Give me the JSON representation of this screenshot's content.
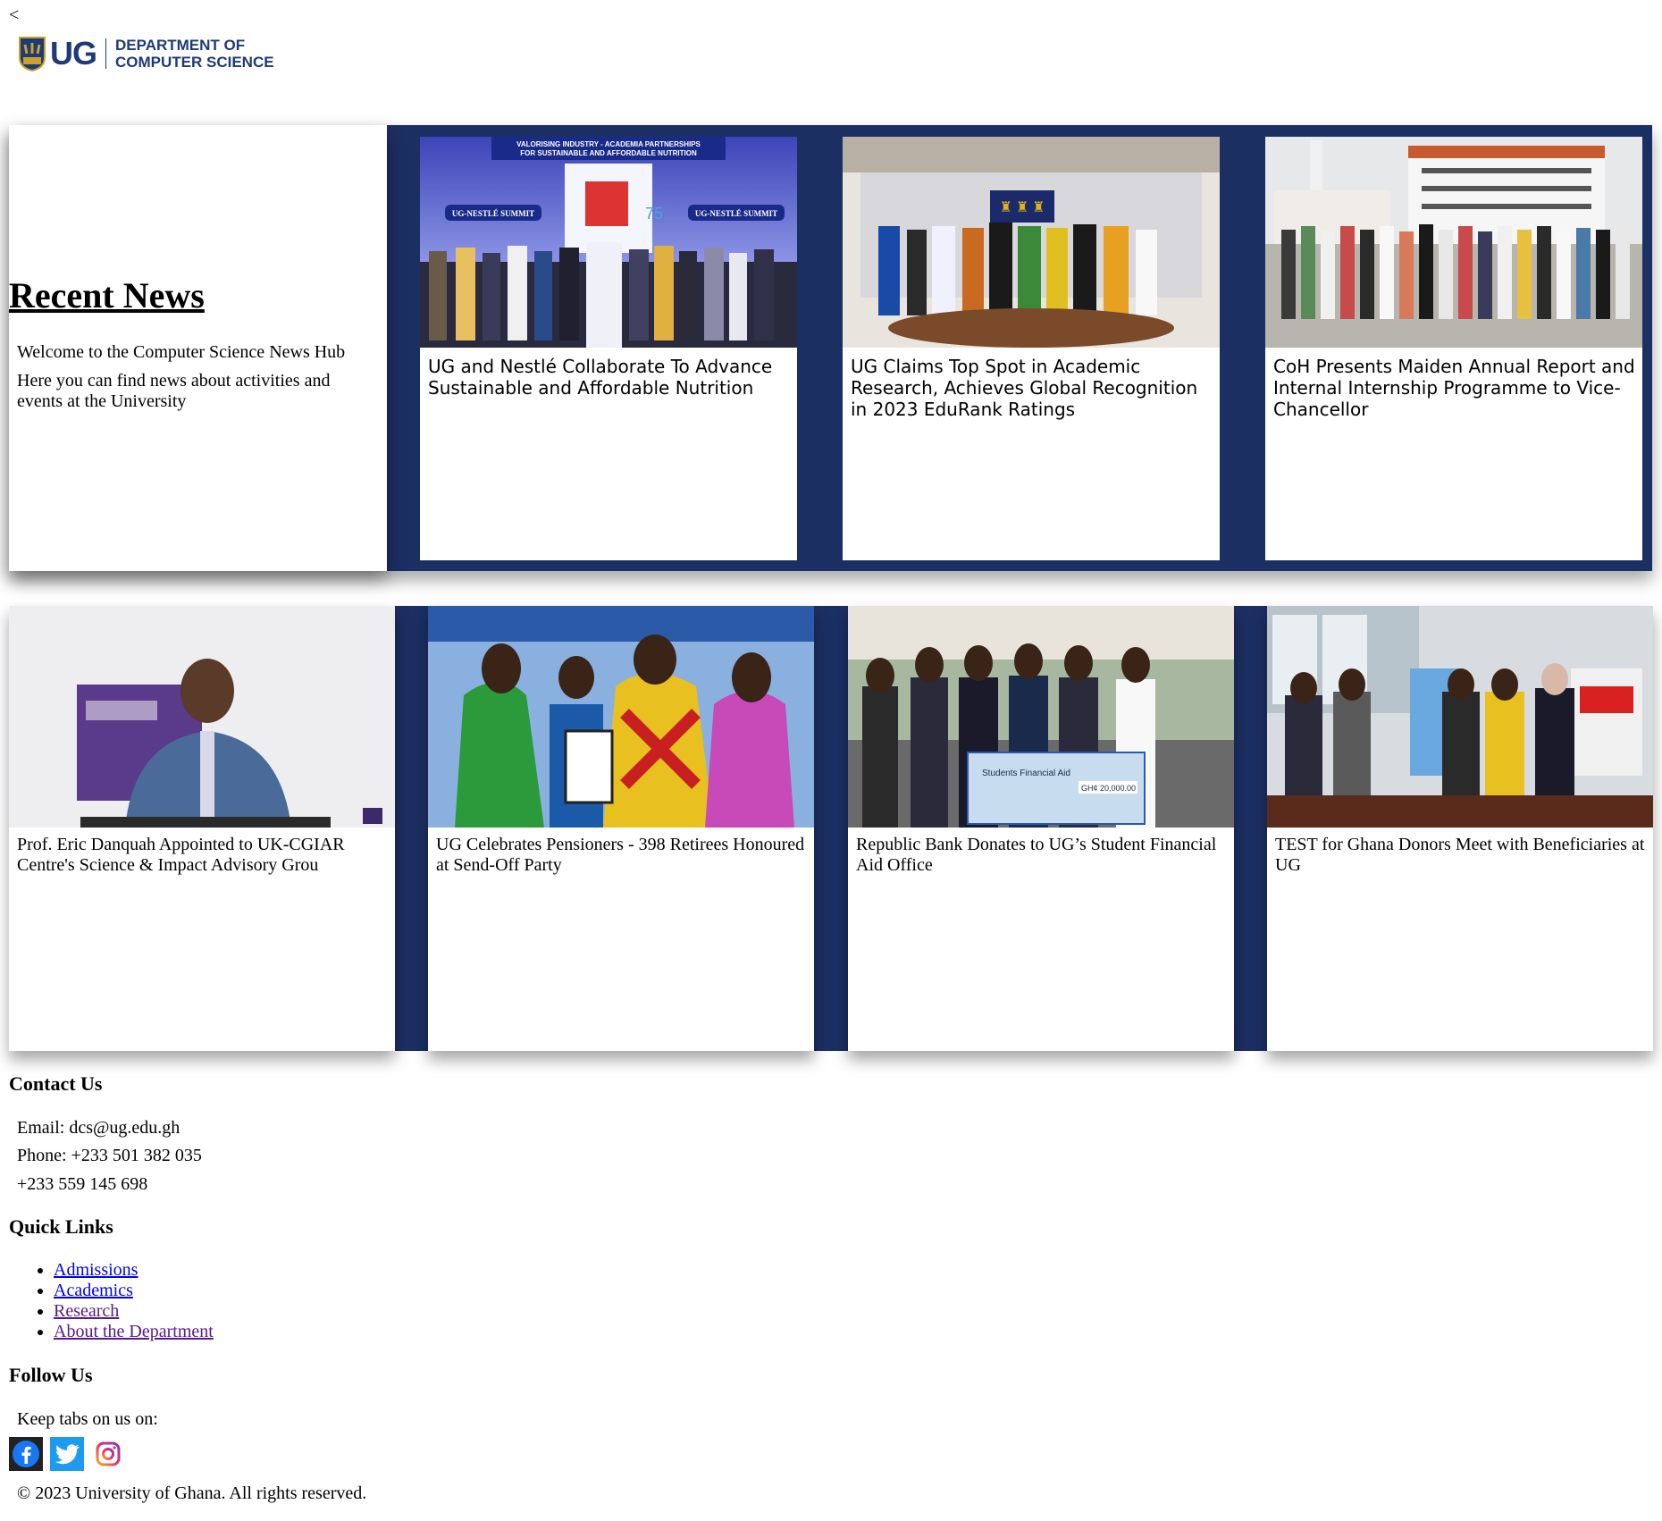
{
  "nav": {
    "back_label": "<"
  },
  "logo": {
    "ug": "UG",
    "dept_line1": "DEPARTMENT OF",
    "dept_line2": "COMPUTER SCIENCE"
  },
  "intro": {
    "title": "Recent News",
    "subtitle": "Welcome to the Computer Science News Hub",
    "text": "Here you can find news about activities and events at the University"
  },
  "featured_news": [
    {
      "caption": "UG and Nestlé Collaborate To Advance Sustainable and Affordable Nutrition",
      "banner": "VALORISING INDUSTRY - ACADEMIA PARTNERSHIPS FOR SUSTAINABLE AND AFFORDABLE NUTRITION",
      "tag": "UG-NESTLÉ SUMMIT"
    },
    {
      "caption": "UG Claims Top Spot in Academic Research, Achieves Global Recognition in 2023 EduRank Ratings"
    },
    {
      "caption": "CoH Presents Maiden Annual Report and Internal Internship Programme to Vice-Chancellor"
    }
  ],
  "news": [
    {
      "caption": "Prof. Eric Danquah Appointed to UK-CGIAR Centre's Science & Impact Advisory Grou"
    },
    {
      "caption": "UG Celebrates Pensioners - 398 Retirees Honoured at Send-Off Party"
    },
    {
      "caption": "Republic Bank Donates to UG’s Student Financial Aid Office",
      "cheque_text": "Students Financial Aid",
      "cheque_amount": "GH¢ 20,000.00"
    },
    {
      "caption": "TEST for Ghana Donors Meet with Beneficiaries at UG"
    }
  ],
  "contact": {
    "heading": "Contact Us",
    "email": "Email: dcs@ug.edu.gh",
    "phone": "Phone: +233 501 382 035",
    "phone2": "+233 559 145 698"
  },
  "quick_links": {
    "heading": "Quick Links",
    "items": [
      "Admissions",
      "Academics",
      "Research",
      "About the Department"
    ]
  },
  "follow": {
    "heading": "Follow Us",
    "text": "Keep tabs on us on:",
    "icons": [
      "facebook-icon",
      "twitter-icon",
      "instagram-icon"
    ]
  },
  "copyright": "© 2023 University of Ghana. All rights reserved.",
  "colors": {
    "navy": "#1c2f63",
    "brand_blue": "#1e3a78",
    "link": "#0000ee",
    "visited": "#551a8b"
  }
}
